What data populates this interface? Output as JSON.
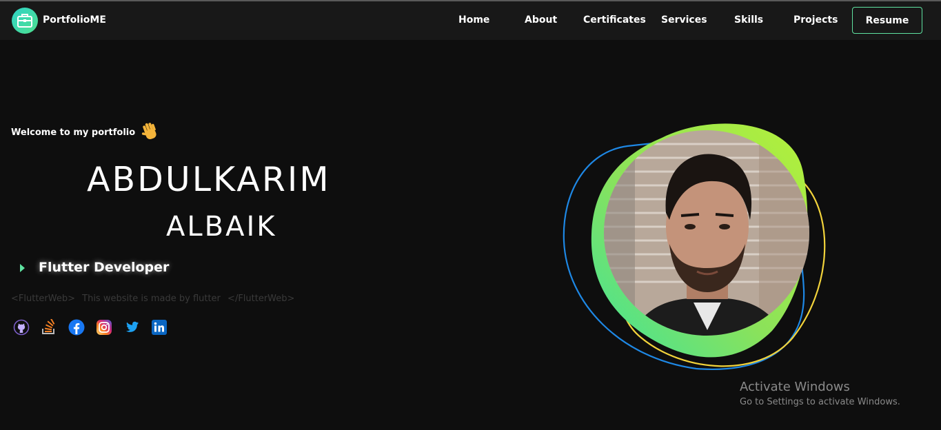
{
  "nav": {
    "logo_text": "PortfolioME",
    "items": [
      {
        "label": "Home"
      },
      {
        "label": "About"
      },
      {
        "label": "Certificates"
      },
      {
        "label": "Services"
      },
      {
        "label": "Skills"
      },
      {
        "label": "Projects"
      }
    ],
    "resume_label": "Resume"
  },
  "hero": {
    "welcome": "Welcome to my portfolio",
    "first_name": "ABDULKARIM",
    "last_name": "ALBAIK",
    "role": "Flutter Developer",
    "tagline_open": "<FlutterWeb>",
    "tagline_text": "This website is made by flutter",
    "tagline_close": "</FlutterWeb>"
  },
  "social": [
    {
      "icon": "github-icon"
    },
    {
      "icon": "stackoverflow-icon"
    },
    {
      "icon": "facebook-icon"
    },
    {
      "icon": "instagram-icon"
    },
    {
      "icon": "twitter-icon"
    },
    {
      "icon": "linkedin-icon"
    }
  ],
  "watermark": {
    "title": "Activate Windows",
    "subtitle": "Go to Settings to activate Windows."
  },
  "colors": {
    "accent": "#5fe3a1",
    "background": "#0e0e0e",
    "navbar": "#181818",
    "blob_green": "#a6ef3c",
    "ring_blue": "#1e88e5",
    "ring_yellow": "#f2d33b"
  }
}
